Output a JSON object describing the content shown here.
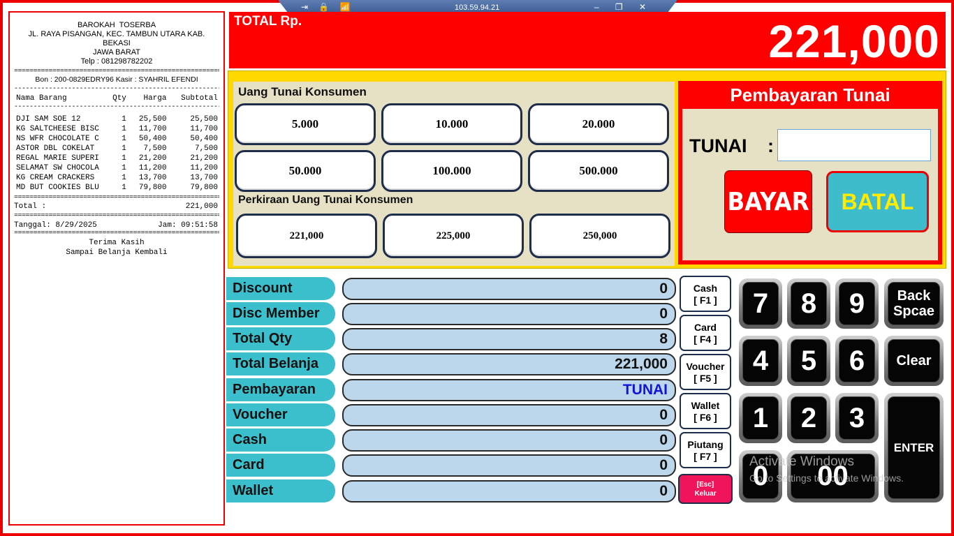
{
  "remote_bar": {
    "ip": "103.59.94.21",
    "left_icons": "⇥ 🔒 📶",
    "right_icons": "‒ ❐ ✕"
  },
  "receipt": {
    "store": "BAROKAH  TOSERBA",
    "address": "JL. RAYA PISANGAN, KEC. TAMBUN UTARA KAB. BEKASI",
    "region": "JAWA BARAT",
    "phone": "Telp : 081298782202",
    "separator": "==================================================================",
    "dash": "------------------------------------------------------------------",
    "bon": "Bon : 200-0829EDRY96  Kasir : SYAHRIL EFENDI",
    "columns": {
      "name": "Nama Barang",
      "qty": "Qty",
      "price": "Harga",
      "subtotal": "Subtotal"
    },
    "items": [
      {
        "name": "DJI SAM SOE 12",
        "qty": "1",
        "price": "25,500",
        "subtotal": "25,500"
      },
      {
        "name": "KG SALTCHEESE BISC",
        "qty": "1",
        "price": "11,700",
        "subtotal": "11,700"
      },
      {
        "name": "NS WFR CHOCOLATE C",
        "qty": "1",
        "price": "50,400",
        "subtotal": "50,400"
      },
      {
        "name": "ASTOR DBL COKELAT",
        "qty": "1",
        "price": "7,500",
        "subtotal": "7,500"
      },
      {
        "name": "REGAL MARIE SUPERI",
        "qty": "1",
        "price": "21,200",
        "subtotal": "21,200"
      },
      {
        "name": "SELAMAT SW CHOCOLA",
        "qty": "1",
        "price": "11,200",
        "subtotal": "11,200"
      },
      {
        "name": "KG CREAM CRACKERS",
        "qty": "1",
        "price": "13,700",
        "subtotal": "13,700"
      },
      {
        "name": "MD BUT COOKIES BLU",
        "qty": "1",
        "price": "79,800",
        "subtotal": "79,800"
      }
    ],
    "total_label": "Total :",
    "total_value": "221,000",
    "date_label": "Tanggal: 8/29/2025",
    "time_label": "Jam: 09:51:58",
    "thanks1": "Terima Kasih",
    "thanks2": "Sampai Belanja Kembali"
  },
  "total_bar": {
    "label": "TOTAL Rp.",
    "value": "221,000"
  },
  "cash_panel": {
    "title": "Uang Tunai Konsumen",
    "denoms": [
      "5.000",
      "10.000",
      "20.000",
      "50.000",
      "100.000",
      "500.000"
    ],
    "estimate_title": "Perkiraan Uang Tunai Konsumen",
    "estimates": [
      "221,000",
      "225,000",
      "250,000"
    ]
  },
  "payment": {
    "title": "Pembayaran Tunai",
    "tunai_label": "TUNAI",
    "colon": ":",
    "tunai_value": "",
    "pay_button": "BAYAR",
    "cancel_button": "BATAL"
  },
  "summary": [
    {
      "label": "Discount",
      "value": "0"
    },
    {
      "label": "Disc Member",
      "value": "0"
    },
    {
      "label": "Total Qty",
      "value": "8"
    },
    {
      "label": "Total Belanja",
      "value": "221,000"
    },
    {
      "label": "Pembayaran",
      "value": "TUNAI"
    },
    {
      "label": "Voucher",
      "value": "0"
    },
    {
      "label": "Cash",
      "value": "0"
    },
    {
      "label": "Card",
      "value": "0"
    },
    {
      "label": "Wallet",
      "value": "0"
    }
  ],
  "methods": [
    {
      "label": "Cash",
      "key": "[ F1 ]"
    },
    {
      "label": "Card",
      "key": "[ F4 ]"
    },
    {
      "label": "Voucher",
      "key": "[ F5 ]"
    },
    {
      "label": "Wallet",
      "key": "[ F6 ]"
    },
    {
      "label": "Piutang",
      "key": "[ F7 ]"
    }
  ],
  "exit_button": {
    "key": "[Esc]",
    "label": "Keluar"
  },
  "keypad": {
    "k7": "7",
    "k8": "8",
    "k9": "9",
    "k4": "4",
    "k5": "5",
    "k6": "6",
    "k1": "1",
    "k2": "2",
    "k3": "3",
    "k0": "0",
    "k00": "00",
    "backspace1": "Back",
    "backspace2": "Spcae",
    "clear": "Clear",
    "enter": "ENTER"
  },
  "watermark": {
    "line1": "Activate Windows",
    "line2": "Go to Settings to activate Windows."
  },
  "colors": {
    "accent_red": "#ff0000",
    "teal": "#3cbfcc",
    "yellow": "#ffd800",
    "field_blue": "#bcd6ec"
  }
}
